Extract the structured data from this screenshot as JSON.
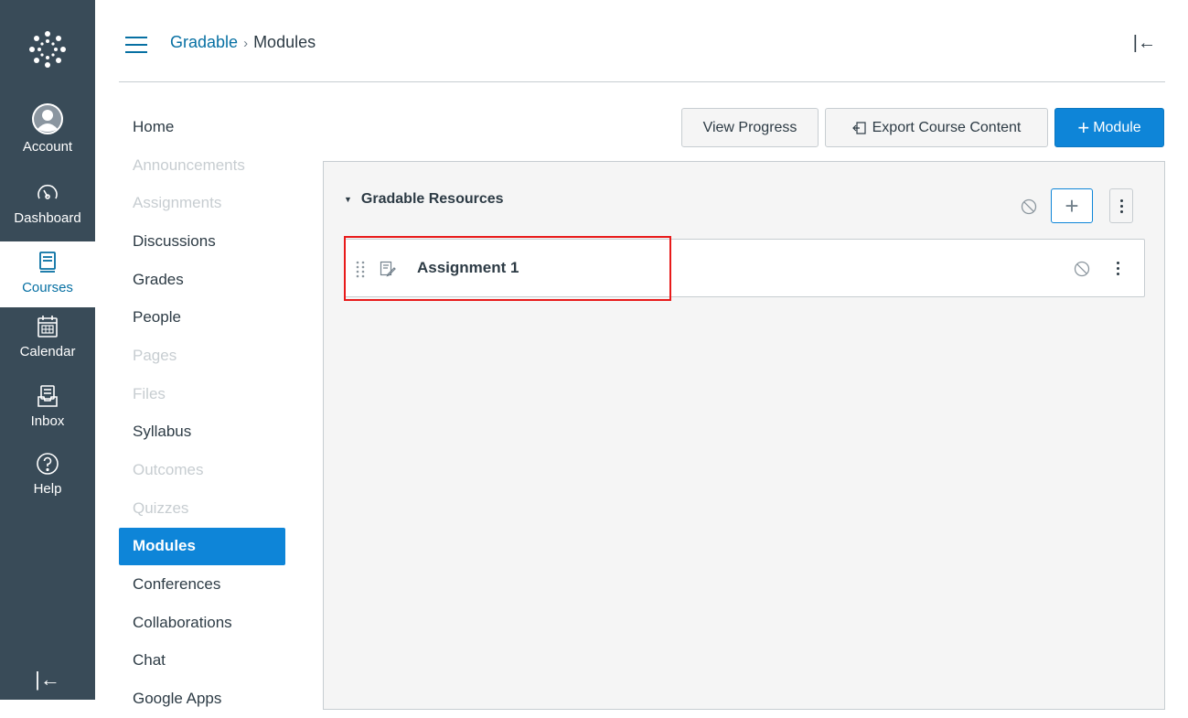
{
  "global_nav": {
    "logo_icon": "canvas-logo-icon",
    "items": [
      {
        "label": "Account",
        "icon": "avatar-icon"
      },
      {
        "label": "Dashboard",
        "icon": "dashboard-gauge-icon"
      },
      {
        "label": "Courses",
        "icon": "courses-book-icon",
        "active": true
      },
      {
        "label": "Calendar",
        "icon": "calendar-icon"
      },
      {
        "label": "Inbox",
        "icon": "inbox-icon"
      },
      {
        "label": "Help",
        "icon": "help-icon"
      }
    ],
    "collapse_glyph": "|←"
  },
  "header": {
    "breadcrumb": {
      "course": "Gradable",
      "separator": "›",
      "current": "Modules"
    },
    "collapse_glyph": "|←"
  },
  "course_nav": {
    "items": [
      {
        "label": "Home",
        "state": "normal"
      },
      {
        "label": "Announcements",
        "state": "disabled"
      },
      {
        "label": "Assignments",
        "state": "disabled"
      },
      {
        "label": "Discussions",
        "state": "normal"
      },
      {
        "label": "Grades",
        "state": "normal"
      },
      {
        "label": "People",
        "state": "normal"
      },
      {
        "label": "Pages",
        "state": "disabled"
      },
      {
        "label": "Files",
        "state": "disabled"
      },
      {
        "label": "Syllabus",
        "state": "normal"
      },
      {
        "label": "Outcomes",
        "state": "disabled"
      },
      {
        "label": "Quizzes",
        "state": "disabled"
      },
      {
        "label": "Modules",
        "state": "active"
      },
      {
        "label": "Conferences",
        "state": "normal"
      },
      {
        "label": "Collaborations",
        "state": "normal"
      },
      {
        "label": "Chat",
        "state": "normal"
      },
      {
        "label": "Google Apps",
        "state": "normal"
      }
    ]
  },
  "toolbar": {
    "view_progress_label": "View Progress",
    "export_label": "Export Course Content",
    "add_module_label": "Module",
    "add_module_glyph": "+"
  },
  "module": {
    "title": "Gradable Resources",
    "add_glyph": "+",
    "items": [
      {
        "title": "Assignment 1",
        "icon": "assignment-icon"
      }
    ]
  },
  "colors": {
    "nav_bg": "#394b58",
    "brand_blue": "#0e85d8",
    "link_blue": "#0770a3",
    "text": "#2d3b45",
    "disabled_text": "#c7cdd1",
    "highlight_red": "#e81a1a"
  }
}
